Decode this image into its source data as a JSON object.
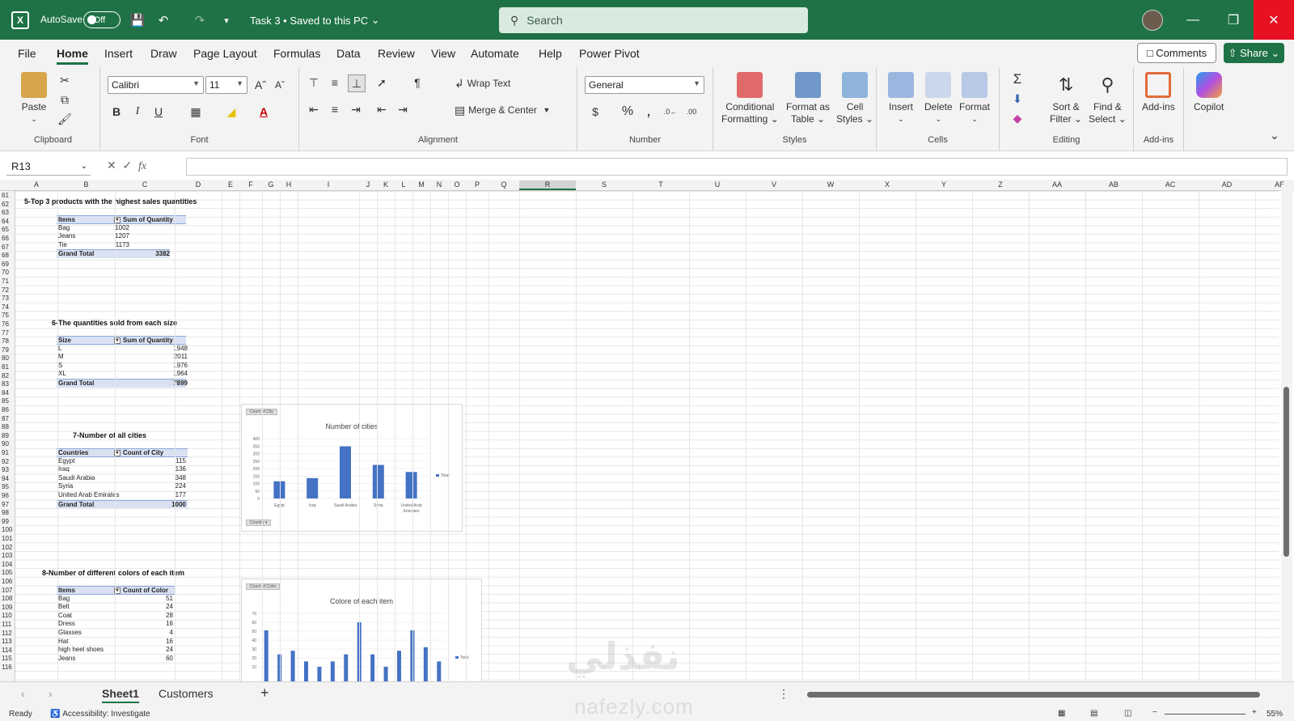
{
  "titlebar": {
    "autosave": "AutoSave",
    "toggle": "Off",
    "doc": "Task 3 • Saved to this PC",
    "search": "Search"
  },
  "menu": [
    "File",
    "Home",
    "Insert",
    "Draw",
    "Page Layout",
    "Formulas",
    "Data",
    "Review",
    "View",
    "Automate",
    "Help",
    "Power Pivot"
  ],
  "comments": "Comments",
  "share": "Share",
  "ribbon": {
    "paste": "Paste",
    "clipboard": "Clipboard",
    "font_name": "Calibri",
    "font_size": "11",
    "font": "Font",
    "wrap": "Wrap Text",
    "merge": "Merge & Center",
    "alignment": "Alignment",
    "numfmt": "General",
    "number": "Number",
    "cond1": "Conditional",
    "cond2": "Formatting",
    "fmt1": "Format as",
    "fmt2": "Table",
    "cell1": "Cell",
    "cell2": "Styles",
    "styles": "Styles",
    "insert": "Insert",
    "delete": "Delete",
    "format": "Format",
    "cells": "Cells",
    "sort1": "Sort &",
    "sort2": "Filter",
    "find1": "Find &",
    "find2": "Select",
    "editing": "Editing",
    "addins": "Add-ins",
    "addins_grp": "Add-ins",
    "copilot": "Copilot"
  },
  "namebox": "R13",
  "columns": [
    "A",
    "B",
    "C",
    "D",
    "E",
    "F",
    "G",
    "H",
    "I",
    "J",
    "K",
    "L",
    "M",
    "N",
    "O",
    "P",
    "Q",
    "R",
    "S",
    "T",
    "U",
    "V",
    "W",
    "X",
    "Y",
    "Z",
    "AA",
    "AB",
    "AC",
    "AD",
    "AE"
  ],
  "rows": [
    "61",
    "62",
    "63",
    "64",
    "65",
    "66",
    "67",
    "68",
    "69",
    "70",
    "71",
    "72",
    "73",
    "74",
    "75",
    "76",
    "77",
    "78",
    "79",
    "80",
    "81",
    "82",
    "83",
    "84",
    "85",
    "86",
    "87",
    "88",
    "89",
    "90",
    "91",
    "92",
    "93",
    "94",
    "95",
    "96",
    "97",
    "98",
    "99",
    "100",
    "101",
    "102",
    "103",
    "104",
    "105",
    "106",
    "107",
    "108",
    "109",
    "110",
    "111",
    "112",
    "113",
    "114",
    "115",
    "116"
  ],
  "sections": {
    "s5": {
      "title": "5-Top 3 products with the highest sales quantities",
      "h1": "Items",
      "h2": "Sum of Quantity",
      "rows": [
        [
          "Bag",
          "1002"
        ],
        [
          "Jeans",
          "1207"
        ],
        [
          "Tie",
          "1173"
        ]
      ],
      "total": [
        "Grand Total",
        "3382"
      ]
    },
    "s6": {
      "title": "6-The quantities sold from each size",
      "h1": "Size",
      "h2": "Sum of Quantity",
      "rows": [
        [
          "L",
          "1948"
        ],
        [
          "M",
          "2011"
        ],
        [
          "S",
          "1976"
        ],
        [
          "XL",
          "1964"
        ]
      ],
      "total": [
        "Grand Total",
        "7899"
      ]
    },
    "s7": {
      "title": "7-Number of all cities",
      "h1": "Countries",
      "h2": "Count of City",
      "rows": [
        [
          "Egypt",
          "115"
        ],
        [
          "Iraq",
          "136"
        ],
        [
          "Saudi Arabia",
          "348"
        ],
        [
          "Syria",
          "224"
        ],
        [
          "United Arab Emirates",
          "177"
        ]
      ],
      "total": [
        "Grand Total",
        "1000"
      ]
    },
    "s8": {
      "title": "8-Number of different colors of each item",
      "h1": "Items",
      "h2": "Count of Color",
      "rows": [
        [
          "Bag",
          "51"
        ],
        [
          "Belt",
          "24"
        ],
        [
          "Coat",
          "28"
        ],
        [
          "Dress",
          "16"
        ],
        [
          "Glasses",
          "4"
        ],
        [
          "Hat",
          "16"
        ],
        [
          "high heel shoes",
          "24"
        ],
        [
          "Jeans",
          "60"
        ]
      ]
    }
  },
  "chart_data": [
    {
      "type": "bar",
      "title": "Number of cities",
      "filter_button": "Count of City",
      "axis_button": "Country",
      "legend": "Total",
      "categories": [
        "Egypt",
        "Iraq",
        "Saudi Arabia",
        "Syria",
        "United Arab Emirates"
      ],
      "values": [
        115,
        136,
        348,
        224,
        177
      ],
      "yticks": [
        "400",
        "350",
        "300",
        "250",
        "200",
        "150",
        "100",
        "50",
        "0"
      ],
      "ylim": [
        0,
        400
      ]
    },
    {
      "type": "bar",
      "title": "Colore of each item",
      "filter_button": "Count of Color",
      "legend": "Total",
      "values": [
        51,
        24,
        28,
        16,
        4,
        16,
        24,
        60,
        24,
        8,
        28,
        51,
        32,
        16
      ],
      "yticks": [
        "70",
        "60",
        "50",
        "40",
        "30",
        "20",
        "10"
      ],
      "ylim": [
        0,
        70
      ]
    }
  ],
  "tabs": {
    "sheet1": "Sheet1",
    "customers": "Customers"
  },
  "status": {
    "ready": "Ready",
    "access": "Accessibility: Investigate",
    "zoom": "55%"
  },
  "watermark": {
    "ar": "نفذلي",
    "en": "nafezly.com"
  }
}
